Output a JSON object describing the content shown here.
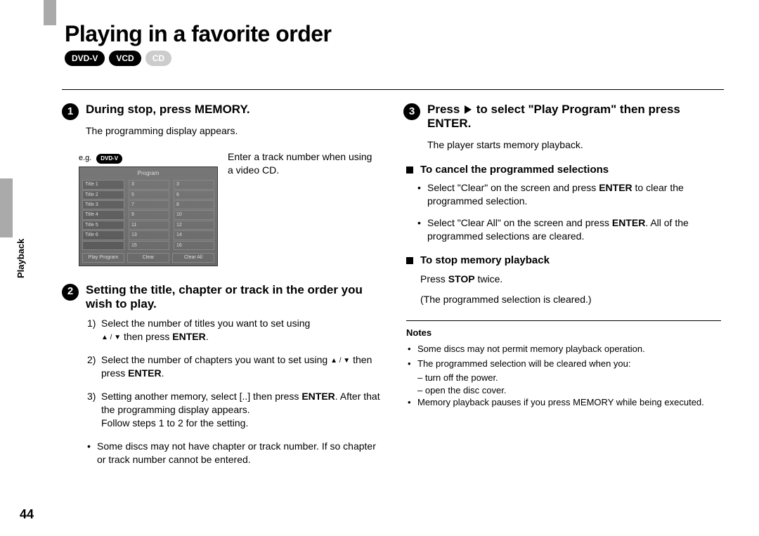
{
  "title": "Playing in a favorite order",
  "side_label": "Playback",
  "page_number": "44",
  "badges": {
    "dvd": "DVD-V",
    "vcd": "VCD",
    "cd": "CD"
  },
  "step1": {
    "heading": "During stop, press MEMORY.",
    "body": "The programming display appears.",
    "eg_prefix": "e.g.",
    "eg_badge": "DVD-V",
    "osd_caption": "Enter a track number when using a video CD.",
    "osd": {
      "title": "Program",
      "rows": [
        [
          "Title 1",
          "3",
          "3"
        ],
        [
          "Title 2",
          "5",
          "6"
        ],
        [
          "Title 3",
          "7",
          "8"
        ],
        [
          "Title 4",
          "9",
          "10"
        ],
        [
          "Title 5",
          "11",
          "12"
        ],
        [
          "Title 6",
          "13",
          "14"
        ],
        [
          "",
          "15",
          "16"
        ]
      ],
      "buttons": [
        "Play Program",
        "Clear",
        "Clear All"
      ]
    }
  },
  "step2": {
    "heading": "Setting the title, chapter or track in the order you wish to play.",
    "items": {
      "i1a": "Select the number of titles you want to set using",
      "i1b_tri": "▲ / ▼",
      "i1c": " then press ",
      "i1d": "ENTER",
      "i2a": "Select the number of chapters you want to set using ",
      "i2b_tri": "▲ / ▼",
      "i2c": " then press ",
      "i2d": "ENTER",
      "i3a": "Setting another memory, select [..] then press ",
      "i3b": "ENTER",
      "i3c": ". After that the programming display appears.",
      "i3d": "Follow steps 1 to 2 for the setting."
    },
    "bullet": "Some discs may not have chapter or track number. If so chapter or track number cannot be entered."
  },
  "step3": {
    "heading_a": "Press ",
    "heading_b": " to select \"Play Program\" then press ENTER.",
    "body": "The player starts memory playback."
  },
  "cancel": {
    "heading": "To cancel the programmed selections",
    "b1a": "Select \"Clear\" on the screen and press ",
    "b1b": "ENTER",
    "b1c": " to clear the programmed selection.",
    "b2a": "Select \"Clear All\" on the screen and press ",
    "b2b": "ENTER",
    "b2c": ". All of the programmed selections are cleared."
  },
  "stop": {
    "heading": "To stop memory playback",
    "l1a": "Press ",
    "l1b": "STOP",
    "l1c": " twice.",
    "l2": "(The programmed selection is cleared.)"
  },
  "notes": {
    "heading": "Notes",
    "n1": "Some discs may not permit memory playback operation.",
    "n2": "The programmed selection will be cleared when you:",
    "n2a": "– turn off the power.",
    "n2b": "– open the disc cover.",
    "n3": "Memory playback pauses if you press MEMORY while being executed."
  }
}
